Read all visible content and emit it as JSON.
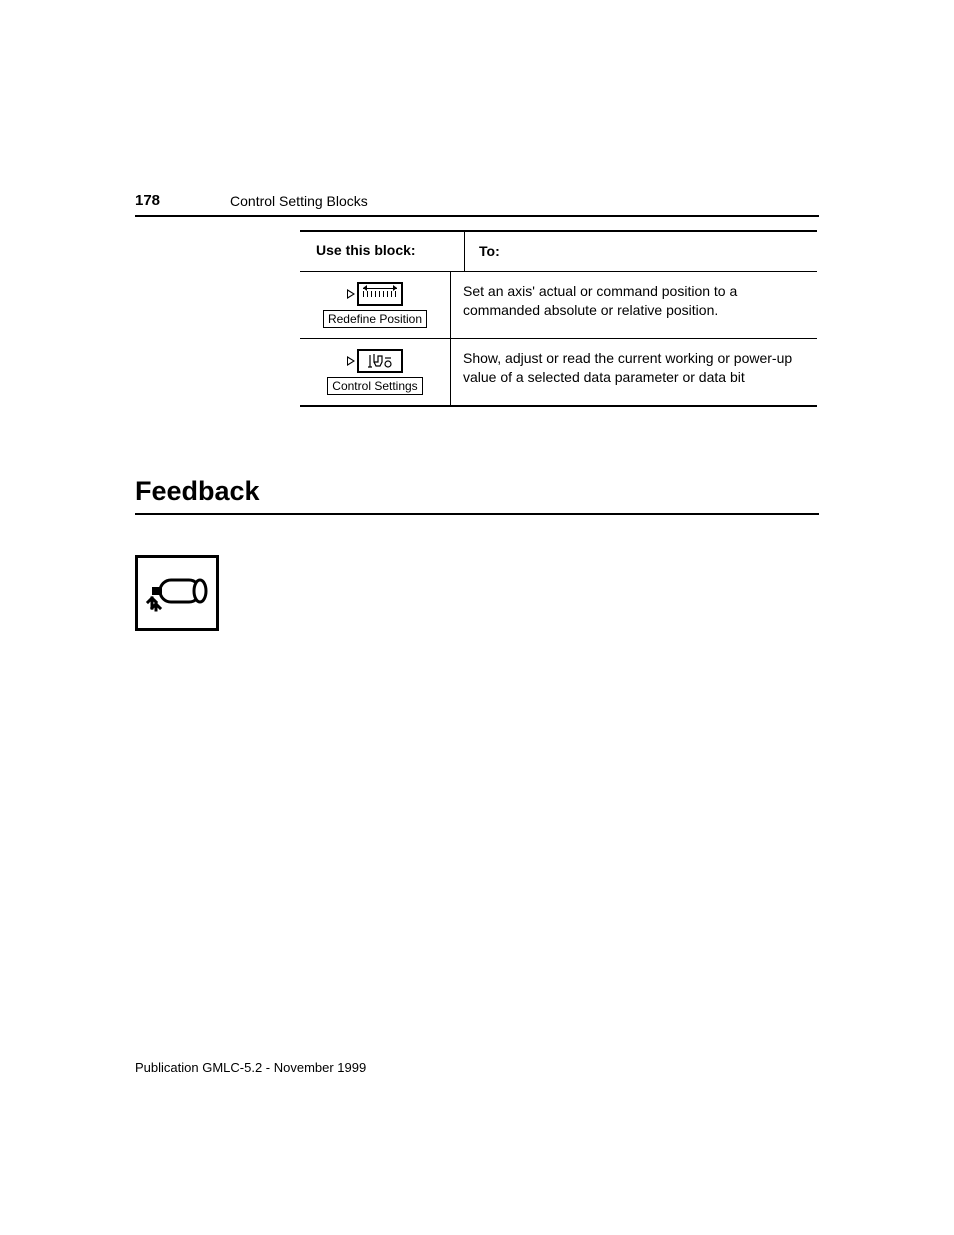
{
  "header": {
    "page_number": "178",
    "section": "Control Setting Blocks"
  },
  "table": {
    "headers": {
      "col1": "Use this block:",
      "col2": "To:"
    },
    "rows": [
      {
        "block_label": "Redefine Position",
        "description": "Set an axis' actual or command position to a commanded absolute or relative position."
      },
      {
        "block_label": "Control Settings",
        "description": "Show, adjust or read the current working or power-up value of a selected data parameter or data bit"
      }
    ]
  },
  "heading": "Feedback",
  "footer": "Publication GMLC-5.2 - November 1999"
}
